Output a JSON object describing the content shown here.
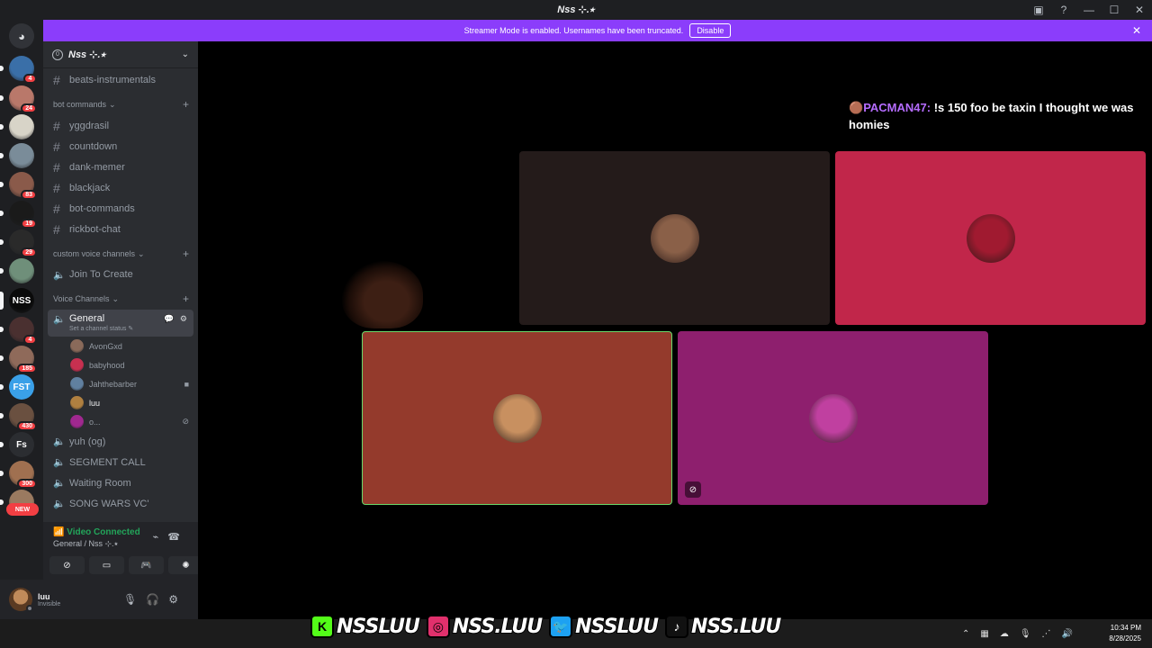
{
  "window": {
    "title": "Nss ⊹.⭑"
  },
  "banner": {
    "text": "Streamer Mode is enabled. Usernames have been truncated.",
    "button": "Disable"
  },
  "servers": [
    {
      "badge": "4",
      "color": "#3a6fa8"
    },
    {
      "badge": "24",
      "color": "#b9786a"
    },
    {
      "badge": "",
      "color": "#d8d4c8"
    },
    {
      "badge": "",
      "color": "#7a8c99"
    },
    {
      "badge": "83",
      "color": "#8a5a4a"
    },
    {
      "badge": "19",
      "color": "#1a1a1a"
    },
    {
      "badge": "29",
      "color": "#2a2a2a"
    },
    {
      "badge": "",
      "color": "#6f8f7a"
    },
    {
      "badge": "",
      "color": "#0a0a0a"
    },
    {
      "badge": "4",
      "color": "#4a3030"
    },
    {
      "badge": "185",
      "color": "#8f6a5a"
    },
    {
      "badge": "",
      "color": "#3aa0e8"
    },
    {
      "badge": "430",
      "color": "#6a5040"
    },
    {
      "badge": "",
      "color": "#2b2d31"
    },
    {
      "badge": "300",
      "color": "#a07050"
    },
    {
      "badge": "",
      "color": "#9a7a60"
    }
  ],
  "server_labels": {
    "fst": "FST",
    "fs": "Fs",
    "nss": "NSS",
    "new": "NEW"
  },
  "guild": {
    "name": "Nss ⊹.⭑",
    "boost": "0"
  },
  "channels": {
    "top": "beats-instrumentals",
    "bot_category": "bot commands",
    "bot": [
      "yggdrasil",
      "countdown",
      "dank-memer",
      "blackjack",
      "bot-commands",
      "rickbot-chat"
    ],
    "custom_category": "custom voice channels",
    "join": "Join To Create",
    "voice_category": "Voice Channels",
    "general": "General",
    "general_status": "Set a channel status",
    "members": [
      {
        "name": "AvonGxd",
        "color": "#8a6a5a"
      },
      {
        "name": "babyhood",
        "color": "#c83050"
      },
      {
        "name": "Jahthebarber",
        "color": "#6080a0"
      },
      {
        "name": "luu",
        "color": "#b08040"
      },
      {
        "name": "o...",
        "color": "#a02890"
      }
    ],
    "voice_rest": [
      "yuh (og)",
      "SEGMENT CALL",
      "Waiting Room",
      "SONG WARS VC'"
    ]
  },
  "voice_panel": {
    "status": "Video Connected",
    "location": "General / Nss ⊹.⭑"
  },
  "user": {
    "name": "luu",
    "status": "Invisible"
  },
  "overlay": {
    "author": "PACMAN47:",
    "message": "!s 150 foo be taxin I thought we was homies"
  },
  "tiles": [
    {
      "bg": "#241b1a",
      "avatar": "#8a6048"
    },
    {
      "bg": "#c1264a",
      "avatar": "#a01a30"
    },
    {
      "bg": "#943a2c",
      "avatar": "#c89060"
    },
    {
      "bg": "#8e1f6e",
      "avatar": "#c040a0"
    }
  ],
  "social": [
    {
      "icon": "K",
      "text": "NSSLUU",
      "color": "#53fc18"
    },
    {
      "icon": "◎",
      "text": "NSS.LUU",
      "color": "#e1306c"
    },
    {
      "icon": "🐦",
      "text": "NSSLUU",
      "color": "#1da1f2"
    },
    {
      "icon": "♪",
      "text": "NSS.LUU",
      "color": "#111111"
    }
  ],
  "taskbar": {
    "time": "10:34 PM",
    "date": "8/28/2025"
  }
}
